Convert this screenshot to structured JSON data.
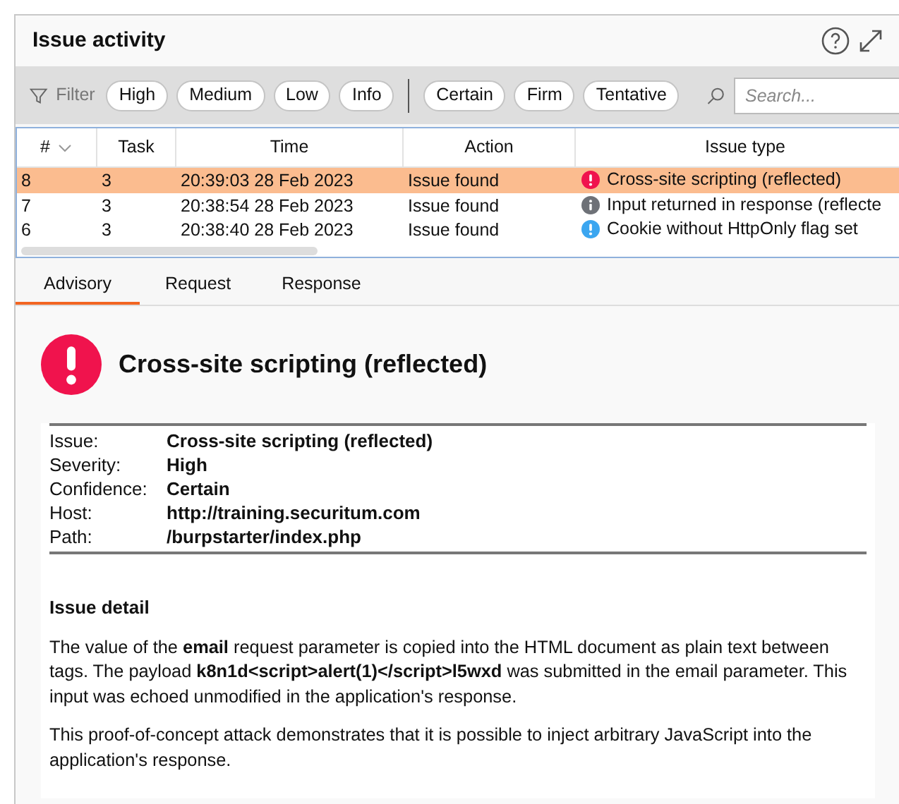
{
  "panel": {
    "title": "Issue activity"
  },
  "filter": {
    "label": "Filter",
    "severity_chips": [
      "High",
      "Medium",
      "Low",
      "Info"
    ],
    "confidence_chips": [
      "Certain",
      "Firm",
      "Tentative"
    ],
    "search": {
      "placeholder": "Search..."
    }
  },
  "table": {
    "columns": [
      "#",
      "Task",
      "Time",
      "Action",
      "Issue type"
    ],
    "rows": [
      {
        "number": "8",
        "task": "3",
        "time": "20:39:03 28 Feb 2023",
        "action": "Issue found",
        "issue_type": "Cross-site scripting (reflected)",
        "kind": "high",
        "selected": true
      },
      {
        "number": "7",
        "task": "3",
        "time": "20:38:54 28 Feb 2023",
        "action": "Issue found",
        "issue_type": "Input returned in response (reflecte",
        "kind": "info",
        "selected": false
      },
      {
        "number": "6",
        "task": "3",
        "time": "20:38:40 28 Feb 2023",
        "action": "Issue found",
        "issue_type": "Cookie without HttpOnly flag set",
        "kind": "low",
        "selected": false
      }
    ]
  },
  "tabs": [
    {
      "label": "Advisory",
      "selected": true
    },
    {
      "label": "Request",
      "selected": false
    },
    {
      "label": "Response",
      "selected": false
    }
  ],
  "advisory": {
    "title": "Cross-site scripting (reflected)",
    "kind": "high",
    "fields": [
      {
        "label": "Issue:",
        "value": "Cross-site scripting (reflected)"
      },
      {
        "label": "Severity:",
        "value": "High"
      },
      {
        "label": "Confidence:",
        "value": "Certain"
      },
      {
        "label": "Host:",
        "value": "http://training.securitum.com"
      },
      {
        "label": "Path:",
        "value": "/burpstarter/index.php"
      }
    ],
    "detail_heading": "Issue detail",
    "paragraphs": [
      "The value of the **email** request parameter is copied into the HTML document as plain text between tags. The payload **k8n1d<script>alert(1)</script>l5wxd** was submitted in the email parameter. This input was echoed unmodified in the application's response.",
      "This proof-of-concept attack demonstrates that it is possible to inject arbitrary JavaScript into the application's response."
    ]
  }
}
